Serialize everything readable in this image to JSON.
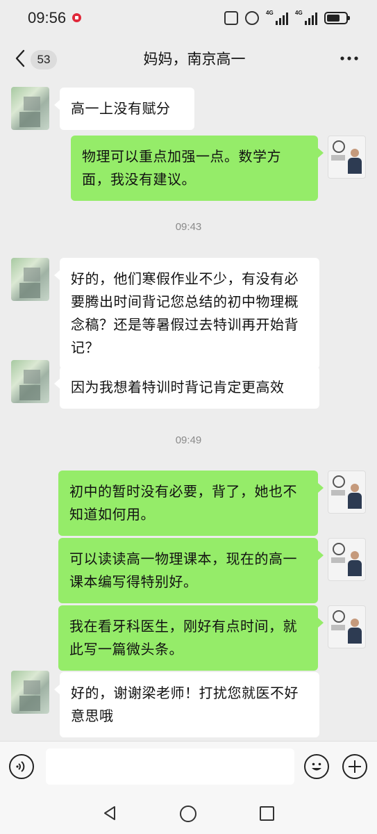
{
  "status_bar": {
    "time": "09:56",
    "signal1_label": "4G",
    "signal2_label": "4G",
    "icons": [
      "red-notification-dot",
      "nfc-icon",
      "alarm-icon",
      "signal-icon",
      "signal-icon",
      "battery-icon"
    ]
  },
  "header": {
    "unread_count": "53",
    "title": "妈妈，南京高一"
  },
  "messages": [
    {
      "side": "in",
      "text": "高一上没有赋分"
    },
    {
      "side": "out",
      "text": "物理可以重点加强一点。数学方面，我没有建议。"
    },
    {
      "side": "in",
      "text": "好的，他们寒假作业不少，有没有必要腾出时间背记您总结的初中物理概念稿？还是等暑假过去特训再开始背记？"
    },
    {
      "side": "in",
      "text": "因为我想着特训时背记肯定更高效"
    },
    {
      "side": "out",
      "text": "初中的暂时没有必要，背了，她也不知道如何用。"
    },
    {
      "side": "out",
      "text": "可以读读高一物理课本，现在的高一课本编写得特别好。"
    },
    {
      "side": "out",
      "text": "我在看牙科医生，刚好有点时间，就此写一篇微头条。"
    },
    {
      "side": "in",
      "text": "好的，谢谢梁老师！打扰您就医不好意思哦"
    }
  ],
  "timestamps": [
    "09:43",
    "09:49"
  ],
  "input_bar": {
    "placeholder": "",
    "icons": [
      "voice-icon",
      "emoji-icon",
      "plus-icon"
    ]
  },
  "system_nav": {
    "icons": [
      "back-triangle-icon",
      "home-circle-icon",
      "recents-square-icon"
    ]
  }
}
